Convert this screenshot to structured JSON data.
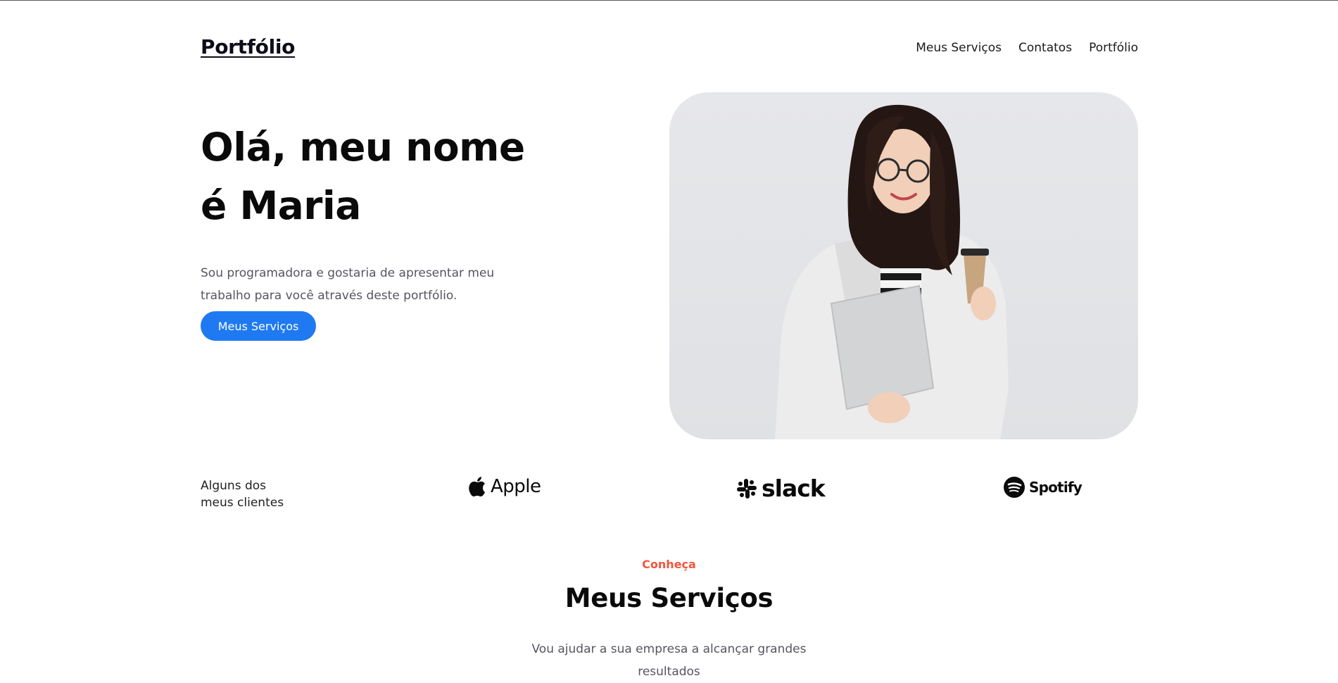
{
  "header": {
    "logo": "Portfólio",
    "nav": [
      "Meus Serviços",
      "Contatos",
      "Portfólio"
    ]
  },
  "hero": {
    "title_line1": "Olá, meu nome",
    "title_line2": "é Maria",
    "description": "Sou programadora e gostaria de apresentar meu trabalho para você através deste portfólio.",
    "button_label": "Meus Serviços"
  },
  "clients": {
    "label_line1": "Alguns dos",
    "label_line2": "meus clientes",
    "logos": [
      "Apple",
      "slack",
      "Spotify"
    ]
  },
  "services": {
    "eyebrow": "Conheça",
    "title": "Meus Serviços",
    "description": "Vou ajudar a sua empresa a alcançar grandes resultados"
  },
  "colors": {
    "accent_blue": "#1f7af2",
    "eyebrow_red": "#f2553d",
    "photo_bg": "#e3e4e7"
  },
  "icons": [
    "apple-logo-icon",
    "slack-logo-icon",
    "spotify-logo-icon"
  ]
}
